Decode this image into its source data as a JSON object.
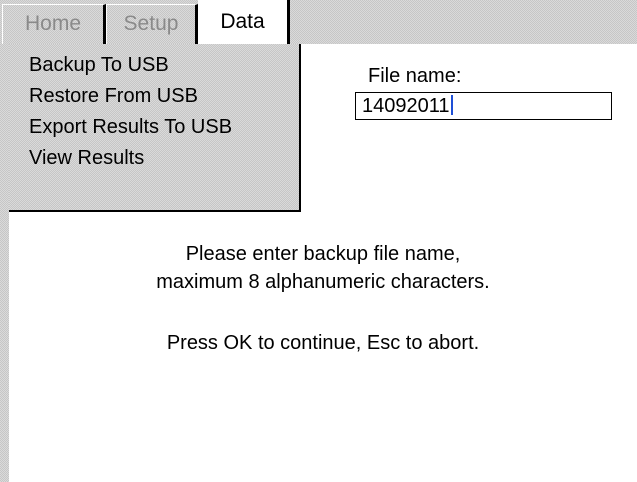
{
  "tabs": {
    "home": "Home",
    "setup": "Setup",
    "data": "Data"
  },
  "menu": {
    "items": [
      {
        "label": "Backup To USB"
      },
      {
        "label": "Restore From USB"
      },
      {
        "label": "Export Results To USB"
      },
      {
        "label": "View Results"
      }
    ]
  },
  "form": {
    "file_label": "File name:",
    "file_value": "14092011"
  },
  "message": {
    "line1": "Please enter backup file name,",
    "line2": "maximum 8 alphanumeric characters.",
    "line3": "Press OK to continue, Esc to abort."
  },
  "colors": {
    "panel_gray": "#c6c6c6",
    "caret_blue": "#1e4fd6"
  }
}
